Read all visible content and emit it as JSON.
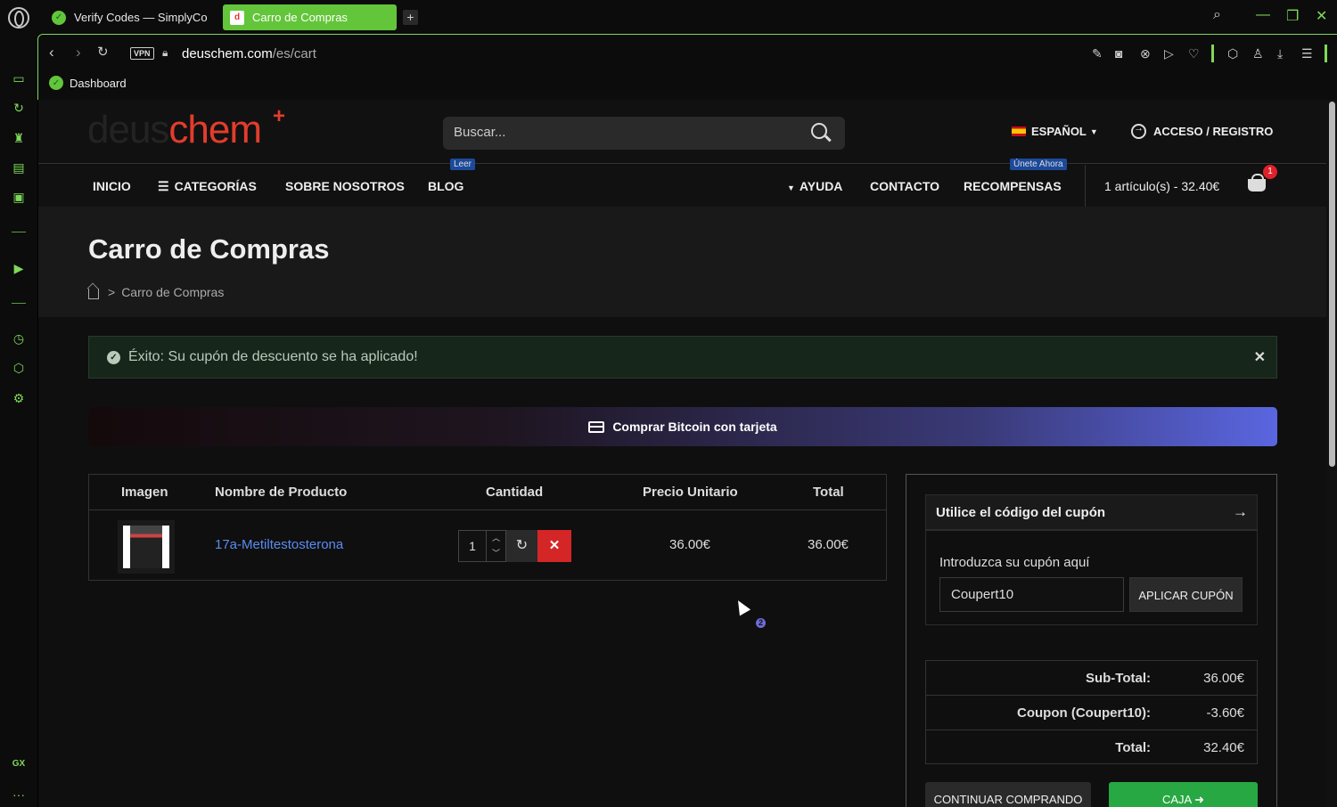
{
  "browser": {
    "tabs": [
      {
        "title": "Verify Codes — SimplyCo"
      },
      {
        "title": "Carro de Compras"
      }
    ],
    "new_tab": "+",
    "url_host": "deuschem.com",
    "url_path": "/es/cart",
    "vpn_label": "VPN",
    "bookmark": "Dashboard",
    "sidebar_label": "GX",
    "sidebar_more": "···"
  },
  "site": {
    "logo_part1": "deus",
    "logo_part2": "chem",
    "logo_plus": "+",
    "search_placeholder": "Buscar...",
    "language": "ESPAÑOL",
    "login": "ACCESO / REGISTRO",
    "nav": {
      "home": "INICIO",
      "categories": "CATEGORÍAS",
      "about": "SOBRE NOSOTROS",
      "blog": "BLOG",
      "blog_badge": "Leer",
      "help": "AYUDA",
      "contact": "CONTACTO",
      "rewards": "RECOMPENSAS",
      "rewards_badge": "Únete Ahora"
    },
    "cart_summary": "1 artículo(s) - 32.40€",
    "cart_count": "1"
  },
  "page": {
    "title": "Carro de Compras",
    "breadcrumb_sep": ">",
    "breadcrumb_current": "Carro de Compras",
    "alert": "Éxito: Su cupón de descuento se ha aplicado!",
    "btc_banner": "Comprar Bitcoin con tarjeta"
  },
  "cart_table": {
    "headers": {
      "image": "Imagen",
      "name": "Nombre de Producto",
      "quantity": "Cantidad",
      "unit_price": "Precio Unitario",
      "total": "Total"
    },
    "rows": [
      {
        "name": "17a-Metiltestosterona",
        "quantity": "1",
        "unit_price": "36.00€",
        "total": "36.00€"
      }
    ]
  },
  "coupon": {
    "heading": "Utilice el código del cupón",
    "label": "Introduzca su cupón aquí",
    "value": "Coupert10",
    "apply": "APLICAR CUPÓN"
  },
  "totals": [
    {
      "label": "Sub-Total:",
      "value": "36.00€"
    },
    {
      "label": "Coupon (Coupert10):",
      "value": "-3.60€"
    },
    {
      "label": "Total:",
      "value": "32.40€"
    }
  ],
  "buttons": {
    "continue": "CONTINUAR COMPRANDO",
    "checkout": "CAJA"
  },
  "cursor_badge": "2",
  "colors": {
    "accent_green": "#7ed957",
    "brand_red": "#e33c2c",
    "remove_red": "#d42626",
    "checkout_green": "#27a843",
    "link_blue": "#5a8cf0"
  }
}
